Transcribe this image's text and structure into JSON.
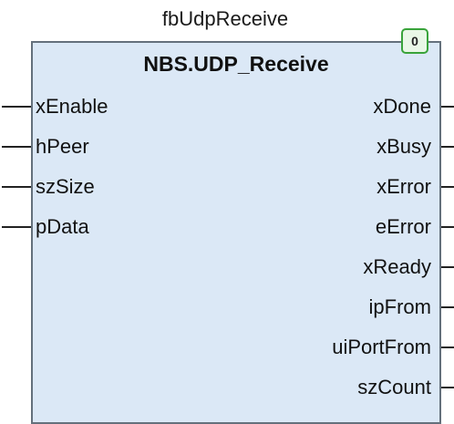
{
  "block": {
    "instance_name": "fbUdpReceive",
    "type_name": "NBS.UDP_Receive",
    "execution_order": "0",
    "inputs": [
      "xEnable",
      "hPeer",
      "szSize",
      "pData"
    ],
    "outputs": [
      "xDone",
      "xBusy",
      "xError",
      "eError",
      "xReady",
      "ipFrom",
      "uiPortFrom",
      "szCount"
    ]
  }
}
